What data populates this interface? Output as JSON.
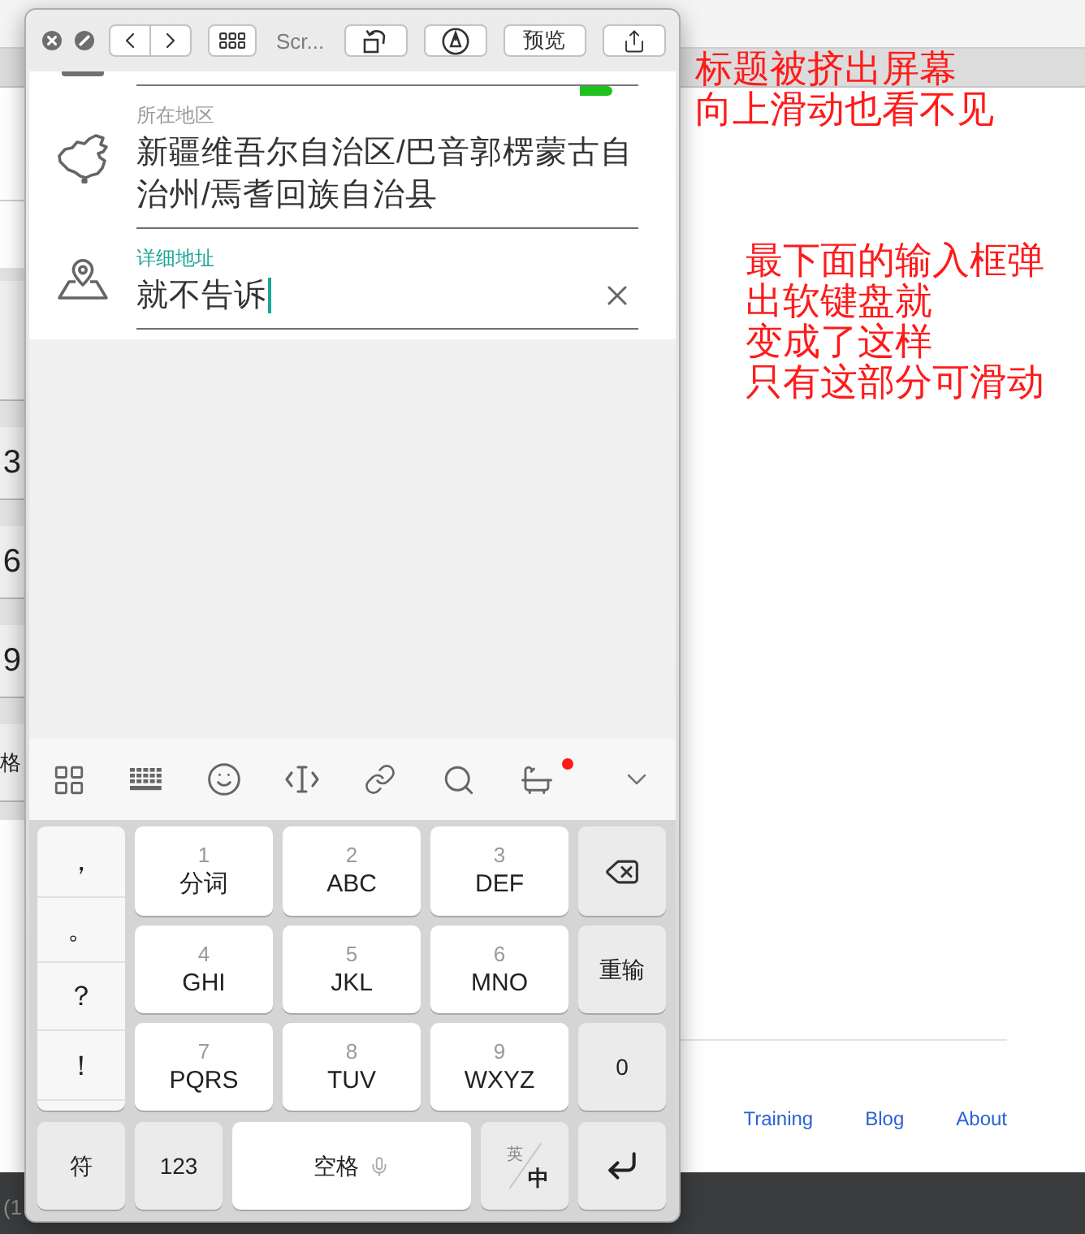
{
  "desktop": {
    "annotations": [
      {
        "lines": [
          "标题被挤出屏幕",
          "向上滑动也看不见"
        ]
      },
      {
        "lines": [
          "最下面的输入框弹",
          "出软键盘就",
          "变成了这样",
          "只有这部分可滑动"
        ]
      }
    ],
    "background_keys": [
      "3",
      "6",
      "9",
      "格"
    ],
    "footer_links": [
      "Training",
      "Blog",
      "About"
    ],
    "status_text": "(1"
  },
  "simulator": {
    "title": "Scr...",
    "preview_button": "预览",
    "form": {
      "fields": [
        {
          "label": "所在地区",
          "value": "新疆维吾尔自治区/巴音郭楞蒙古自治州/焉耆回族自治县",
          "focused": false
        },
        {
          "label": "详细地址",
          "value": "就不告诉",
          "focused": true
        }
      ]
    },
    "keyboard": {
      "toolbar_badge": true,
      "punctuation": [
        "，",
        "。",
        "？",
        "！"
      ],
      "keys": [
        {
          "kind": "t9",
          "digit": "1",
          "letters": "分词"
        },
        {
          "kind": "t9",
          "digit": "2",
          "letters": "ABC"
        },
        {
          "kind": "t9",
          "digit": "3",
          "letters": "DEF"
        },
        {
          "kind": "delete"
        },
        {
          "kind": "t9",
          "digit": "4",
          "letters": "GHI"
        },
        {
          "kind": "t9",
          "digit": "5",
          "letters": "JKL"
        },
        {
          "kind": "t9",
          "digit": "6",
          "letters": "MNO"
        },
        {
          "kind": "function",
          "label": "重输"
        },
        {
          "kind": "t9",
          "digit": "7",
          "letters": "PQRS"
        },
        {
          "kind": "t9",
          "digit": "8",
          "letters": "TUV"
        },
        {
          "kind": "t9",
          "digit": "9",
          "letters": "WXYZ"
        },
        {
          "kind": "function",
          "label": "0"
        }
      ],
      "bottom_keys": [
        {
          "kind": "function",
          "label": "符"
        },
        {
          "kind": "function",
          "label": "123"
        },
        {
          "kind": "space",
          "label": "空格"
        },
        {
          "kind": "lang",
          "secondary": "英",
          "primary": "中"
        },
        {
          "kind": "enter"
        }
      ]
    }
  }
}
